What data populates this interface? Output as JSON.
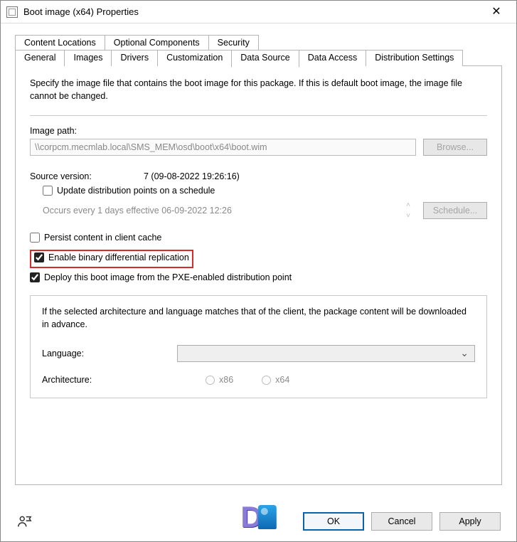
{
  "window": {
    "title": "Boot image (x64) Properties",
    "close_glyph": "✕"
  },
  "tabs": {
    "row1": [
      "Content Locations",
      "Optional Components",
      "Security"
    ],
    "row2": [
      "General",
      "Images",
      "Drivers",
      "Customization",
      "Data Source",
      "Data Access",
      "Distribution Settings"
    ],
    "active": "Data Source"
  },
  "panel": {
    "intro": "Specify the image file that contains the boot image for this package. If this is default boot image, the image file cannot be changed.",
    "image_path_label": "Image path:",
    "image_path_value": "\\\\corpcm.mecmlab.local\\SMS_MEM\\osd\\boot\\x64\\boot.wim",
    "browse_label": "Browse...",
    "source_version_label": "Source version:",
    "source_version_value": "7 (09-08-2022 19:26:16)",
    "update_dp_label": "Update distribution points on a schedule",
    "update_dp_checked": false,
    "schedule_text": "Occurs every 1 days effective 06-09-2022 12:26",
    "schedule_button": "Schedule...",
    "persist_label": "Persist content in client cache",
    "persist_checked": false,
    "bdr_label": "Enable binary differential replication",
    "bdr_checked": true,
    "pxe_label": "Deploy this boot image from the PXE-enabled distribution point",
    "pxe_checked": true,
    "group_text": "If the selected architecture and language matches that of the client, the package content will be downloaded in advance.",
    "language_label": "Language:",
    "architecture_label": "Architecture:",
    "arch_x86": "x86",
    "arch_x64": "x64"
  },
  "footer": {
    "ok": "OK",
    "cancel": "Cancel",
    "apply": "Apply"
  }
}
